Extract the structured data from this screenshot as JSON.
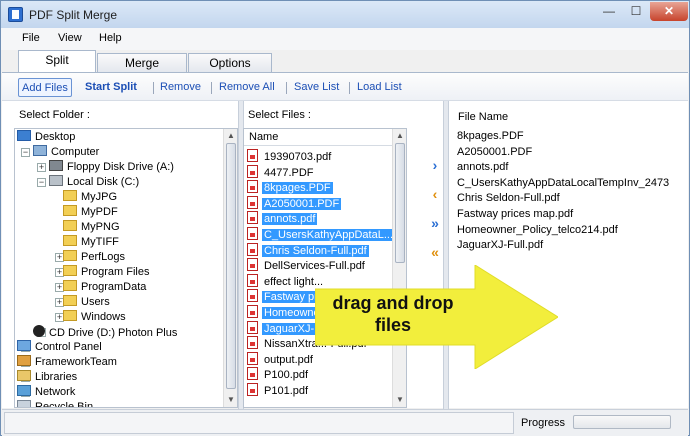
{
  "window": {
    "title": "PDF Split Merge",
    "controls": {
      "minimize": "—",
      "maximize": "☐",
      "close": "✕"
    }
  },
  "menu": [
    "File",
    "View",
    "Help"
  ],
  "tabs": [
    "Split",
    "Merge",
    "Options"
  ],
  "toolbar": {
    "add_files": "Add Files",
    "start_split": "Start Split",
    "remove": "Remove",
    "remove_all": "Remove All",
    "save_list": "Save List",
    "load_list": "Load List"
  },
  "folder_pane": {
    "header": "Select Folder :",
    "tree": [
      {
        "label": "Desktop",
        "icon": "desktop-icon"
      },
      {
        "label": "Computer",
        "icon": "computer-icon"
      },
      {
        "label": "Floppy Disk Drive (A:)",
        "icon": "floppy-icon"
      },
      {
        "label": "Local Disk (C:)",
        "icon": "disk-icon"
      },
      {
        "label": "MyJPG",
        "icon": "folder-icon"
      },
      {
        "label": "MyPDF",
        "icon": "folder-icon"
      },
      {
        "label": "MyPNG",
        "icon": "folder-icon"
      },
      {
        "label": "MyTIFF",
        "icon": "folder-icon"
      },
      {
        "label": "PerfLogs",
        "icon": "folder-icon"
      },
      {
        "label": "Program Files",
        "icon": "folder-icon"
      },
      {
        "label": "ProgramData",
        "icon": "folder-icon"
      },
      {
        "label": "Users",
        "icon": "folder-icon"
      },
      {
        "label": "Windows",
        "icon": "folder-icon"
      },
      {
        "label": "CD Drive (D:) Photon Plus",
        "icon": "cd-icon"
      },
      {
        "label": "Control Panel",
        "icon": "control-panel-icon"
      },
      {
        "label": "FrameworkTeam",
        "icon": "user-folder-icon"
      },
      {
        "label": "Libraries",
        "icon": "libraries-icon"
      },
      {
        "label": "Network",
        "icon": "network-icon"
      },
      {
        "label": "Recycle Bin",
        "icon": "recycle-bin-icon"
      }
    ]
  },
  "files_pane": {
    "header": "Select Files :",
    "column": "Name",
    "files": [
      {
        "name": "19390703.pdf",
        "selected": false
      },
      {
        "name": "4477.PDF",
        "selected": false
      },
      {
        "name": "8kpages.PDF",
        "selected": true
      },
      {
        "name": "A2050001.PDF",
        "selected": true
      },
      {
        "name": "annots.pdf",
        "selected": true
      },
      {
        "name": "C_UsersKathyAppDataL...",
        "selected": true
      },
      {
        "name": "Chris Seldon-Full.pdf",
        "selected": true
      },
      {
        "name": "DellServices-Full.pdf",
        "selected": false
      },
      {
        "name": "effect light...",
        "selected": false
      },
      {
        "name": "Fastway price...",
        "selected": true
      },
      {
        "name": "Homeowner_P...",
        "selected": true
      },
      {
        "name": "JaguarXJ-Full...",
        "selected": true
      },
      {
        "name": "NissanXtra...-Full.pdf",
        "selected": false
      },
      {
        "name": "output.pdf",
        "selected": false
      },
      {
        "name": "P100.pdf",
        "selected": false
      },
      {
        "name": "P101.pdf",
        "selected": false
      }
    ]
  },
  "transfer_buttons": [
    {
      "glyph": "›",
      "icon": "move-right-icon",
      "color": "blue"
    },
    {
      "glyph": "‹",
      "icon": "move-left-icon",
      "color": "orange"
    },
    {
      "glyph": "»",
      "icon": "move-all-right-icon",
      "color": "blue"
    },
    {
      "glyph": "«",
      "icon": "move-all-left-icon",
      "color": "orange"
    }
  ],
  "output_pane": {
    "column": "File Name",
    "files": [
      "8kpages.PDF",
      "A2050001.PDF",
      "annots.pdf",
      "C_UsersKathyAppDataLocalTempInv_2473",
      "Chris Seldon-Full.pdf",
      "Fastway prices map.pdf",
      "Homeowner_Policy_telco214.pdf",
      "JaguarXJ-Full.pdf"
    ]
  },
  "callout": {
    "line1": "drag and drop",
    "line2": "files",
    "color": "#f2ee3c"
  },
  "status": {
    "progress_label": "Progress"
  }
}
